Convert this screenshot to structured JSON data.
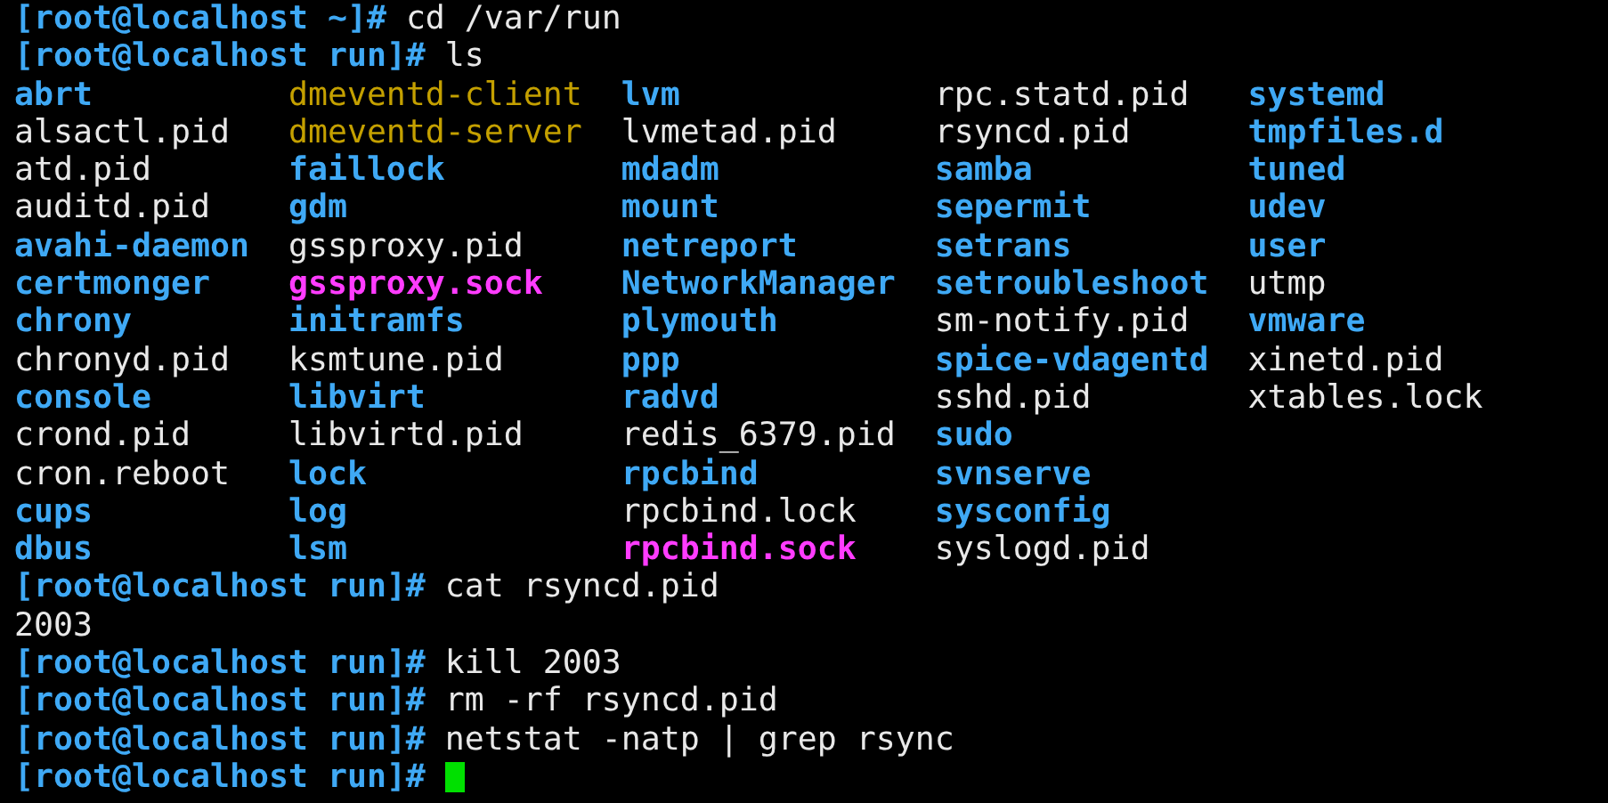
{
  "terminal": {
    "lines": [
      {
        "kind": "prompt",
        "prompt": "[root@localhost ~]#",
        "command": "cd /var/run"
      },
      {
        "kind": "prompt",
        "prompt": "[root@localhost run]#",
        "command": "ls"
      },
      {
        "kind": "listing",
        "columns": [
          [
            {
              "name": "abrt",
              "kind": "dir"
            },
            {
              "name": "alsactl.pid",
              "kind": "file"
            },
            {
              "name": "atd.pid",
              "kind": "file"
            },
            {
              "name": "auditd.pid",
              "kind": "file"
            },
            {
              "name": "avahi-daemon",
              "kind": "dir"
            },
            {
              "name": "certmonger",
              "kind": "dir"
            },
            {
              "name": "chrony",
              "kind": "dir"
            },
            {
              "name": "chronyd.pid",
              "kind": "file"
            },
            {
              "name": "console",
              "kind": "dir"
            },
            {
              "name": "crond.pid",
              "kind": "file"
            },
            {
              "name": "cron.reboot",
              "kind": "file"
            },
            {
              "name": "cups",
              "kind": "dir"
            },
            {
              "name": "dbus",
              "kind": "dir"
            }
          ],
          [
            {
              "name": "dmeventd-client",
              "kind": "fifo"
            },
            {
              "name": "dmeventd-server",
              "kind": "fifo"
            },
            {
              "name": "faillock",
              "kind": "dir"
            },
            {
              "name": "gdm",
              "kind": "dir"
            },
            {
              "name": "gssproxy.pid",
              "kind": "file"
            },
            {
              "name": "gssproxy.sock",
              "kind": "socket"
            },
            {
              "name": "initramfs",
              "kind": "dir"
            },
            {
              "name": "ksmtune.pid",
              "kind": "file"
            },
            {
              "name": "libvirt",
              "kind": "dir"
            },
            {
              "name": "libvirtd.pid",
              "kind": "file"
            },
            {
              "name": "lock",
              "kind": "dir"
            },
            {
              "name": "log",
              "kind": "dir"
            },
            {
              "name": "lsm",
              "kind": "dir"
            }
          ],
          [
            {
              "name": "lvm",
              "kind": "dir"
            },
            {
              "name": "lvmetad.pid",
              "kind": "file"
            },
            {
              "name": "mdadm",
              "kind": "dir"
            },
            {
              "name": "mount",
              "kind": "dir"
            },
            {
              "name": "netreport",
              "kind": "dir"
            },
            {
              "name": "NetworkManager",
              "kind": "dir"
            },
            {
              "name": "plymouth",
              "kind": "dir"
            },
            {
              "name": "ppp",
              "kind": "dir"
            },
            {
              "name": "radvd",
              "kind": "dir"
            },
            {
              "name": "redis_6379.pid",
              "kind": "file"
            },
            {
              "name": "rpcbind",
              "kind": "dir"
            },
            {
              "name": "rpcbind.lock",
              "kind": "file"
            },
            {
              "name": "rpcbind.sock",
              "kind": "socket"
            }
          ],
          [
            {
              "name": "rpc.statd.pid",
              "kind": "file"
            },
            {
              "name": "rsyncd.pid",
              "kind": "file"
            },
            {
              "name": "samba",
              "kind": "dir"
            },
            {
              "name": "sepermit",
              "kind": "dir"
            },
            {
              "name": "setrans",
              "kind": "dir"
            },
            {
              "name": "setroubleshoot",
              "kind": "dir"
            },
            {
              "name": "sm-notify.pid",
              "kind": "file"
            },
            {
              "name": "spice-vdagentd",
              "kind": "dir"
            },
            {
              "name": "sshd.pid",
              "kind": "file"
            },
            {
              "name": "sudo",
              "kind": "dir"
            },
            {
              "name": "svnserve",
              "kind": "dir"
            },
            {
              "name": "sysconfig",
              "kind": "dir"
            },
            {
              "name": "syslogd.pid",
              "kind": "file"
            }
          ],
          [
            {
              "name": "systemd",
              "kind": "dir"
            },
            {
              "name": "tmpfiles.d",
              "kind": "dir"
            },
            {
              "name": "tuned",
              "kind": "dir"
            },
            {
              "name": "udev",
              "kind": "dir"
            },
            {
              "name": "user",
              "kind": "dir"
            },
            {
              "name": "utmp",
              "kind": "file"
            },
            {
              "name": "vmware",
              "kind": "dir"
            },
            {
              "name": "xinetd.pid",
              "kind": "file"
            },
            {
              "name": "xtables.lock",
              "kind": "file"
            }
          ]
        ]
      },
      {
        "kind": "prompt",
        "prompt": "[root@localhost run]#",
        "command": "cat rsyncd.pid"
      },
      {
        "kind": "output",
        "text": "2003"
      },
      {
        "kind": "prompt",
        "prompt": "[root@localhost run]#",
        "command": "kill 2003"
      },
      {
        "kind": "prompt",
        "prompt": "[root@localhost run]#",
        "command": "rm -rf rsyncd.pid"
      },
      {
        "kind": "prompt",
        "prompt": "[root@localhost run]#",
        "command": "netstat -natp | grep rsync"
      },
      {
        "kind": "prompt",
        "prompt": "[root@localhost run]#",
        "cursor": true
      }
    ]
  }
}
